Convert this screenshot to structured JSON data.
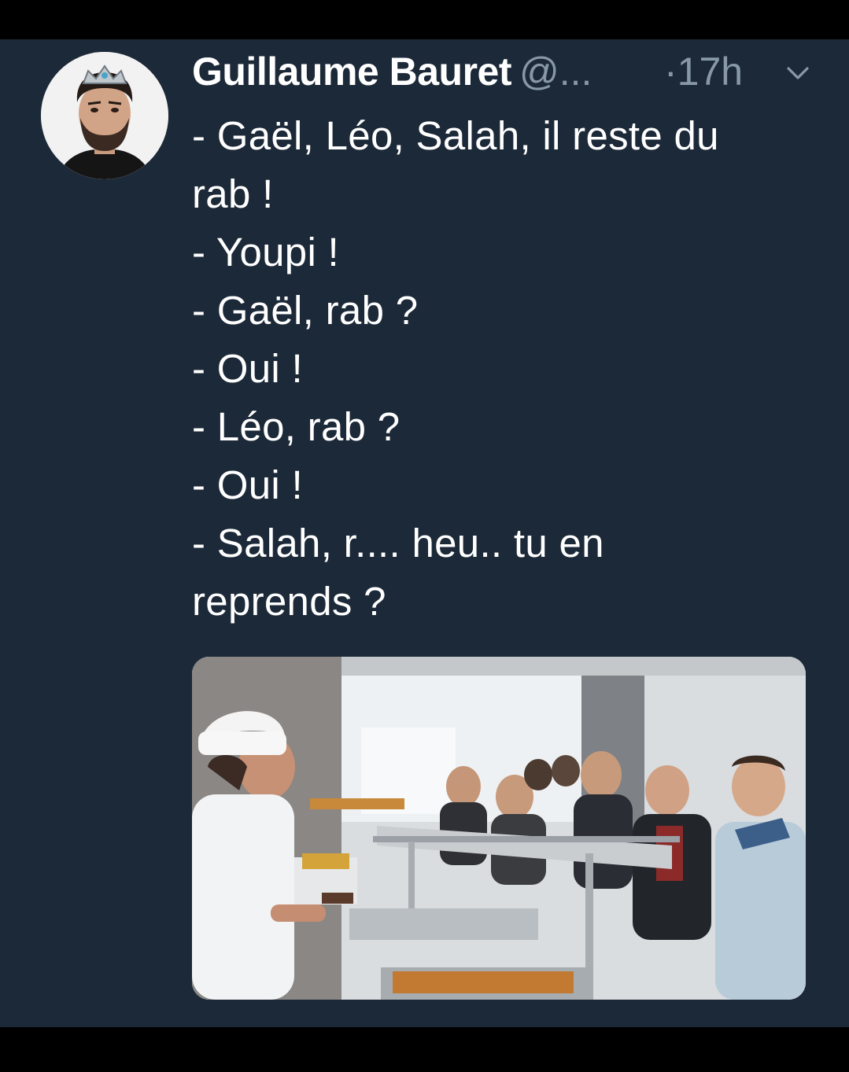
{
  "tweet": {
    "author_name": "Guillaume Bauret",
    "handle": "@...",
    "time": "·17h",
    "text_lines": [
      "- Gaël, Léo, Salah, il reste du",
      "rab !",
      "- Youpi !",
      "- Gaël, rab ?",
      "- Oui !",
      "- Léo, rab ?",
      "- Oui !",
      "- Salah, r.... heu.. tu en",
      "reprends ?"
    ],
    "avatar_icon": "user-avatar-photo",
    "caret_icon": "chevron-down-icon",
    "media_icon": "cafeteria-photo"
  },
  "colors": {
    "background": "#1c2938",
    "text": "#ffffff",
    "secondary_text": "#8899a6",
    "frame": "#000000"
  }
}
